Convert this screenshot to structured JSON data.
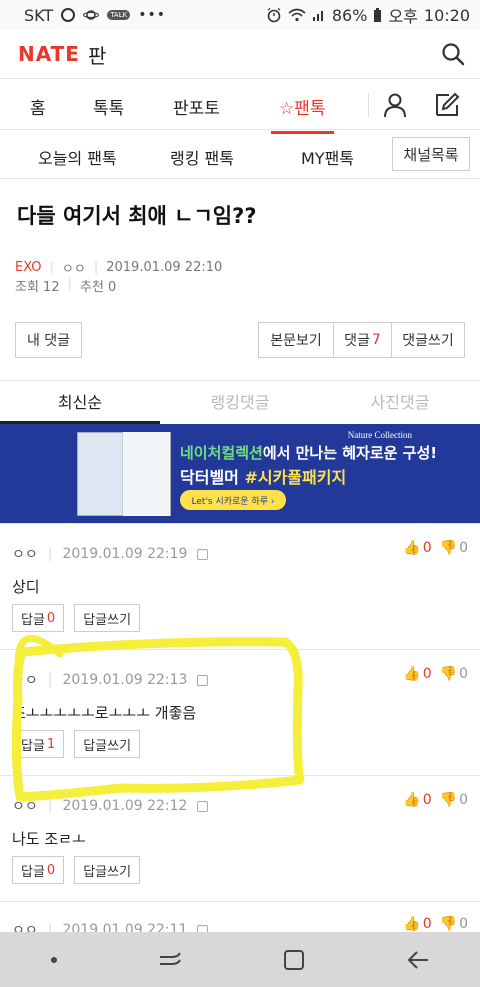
{
  "statusbar": {
    "carrier": "SKT",
    "talk": "TALK",
    "more": "•••",
    "battery": "86%",
    "ampm": "오후",
    "time": "10:20"
  },
  "appbar": {
    "logo": "NATE",
    "logo_sub": "판"
  },
  "tabs": [
    {
      "label": "홈"
    },
    {
      "label": "톡톡"
    },
    {
      "label": "판포토"
    },
    {
      "label": "☆팬톡",
      "active": true
    }
  ],
  "subnav": {
    "items": [
      "오늘의 팬톡",
      "랭킹 팬톡",
      "MY팬톡"
    ],
    "channel_btn": "채널목록"
  },
  "post": {
    "title": "다들 여기서 최애 ㄴㄱ임??",
    "category": "EXO",
    "author": "ㅇㅇ",
    "datetime": "2019.01.09 22:10",
    "views": "조회 12",
    "recommends": "추천 0"
  },
  "buttons": {
    "my_comments": "내 댓글",
    "view_body": "본문보기",
    "comments": "댓글",
    "comments_count": "7",
    "write_comment": "댓글쓰기"
  },
  "sort_tabs": [
    "최신순",
    "랭킹댓글",
    "사진댓글"
  ],
  "banner": {
    "brand": "Nature Collection",
    "line1_green": "네이처컬렉션",
    "line1_rest": "에서 만나는 혜자로운 구성!",
    "line2_white": "닥터벨머 ",
    "line2_yellow": "#시카풀패키지",
    "cta": "Let's 시카로운 하루 ›",
    "colors": {
      "background": "#23399a",
      "green": "#6fe07f",
      "yellow": "#ffe14a"
    }
  },
  "comments": [
    {
      "nick": "ㅇㅇ",
      "datetime": "2019.01.09 22:19",
      "up": "0",
      "down": "0",
      "body": "상디",
      "reply_label": "답글",
      "reply_count": "0",
      "write_reply": "답글쓰기"
    },
    {
      "nick": "ㅇㅇ",
      "datetime": "2019.01.09 22:13",
      "up": "0",
      "down": "0",
      "body": "조ㅗㅗㅗㅗㅗ로ㅗㅗㅗ 개좋음",
      "reply_label": "답글",
      "reply_count": "1",
      "write_reply": "답글쓰기"
    },
    {
      "nick": "ㅇㅇ",
      "datetime": "2019.01.09 22:12",
      "up": "0",
      "down": "0",
      "body": "나도 조ㄹㅗ",
      "reply_label": "답글",
      "reply_count": "0",
      "write_reply": "답글쓰기"
    },
    {
      "nick": "ㅇㅇ",
      "datetime": "2019.01.09 22:11",
      "up": "0",
      "down": "0"
    }
  ],
  "colors": {
    "accent": "#e8372c",
    "annotation": "#f5ee3a"
  }
}
